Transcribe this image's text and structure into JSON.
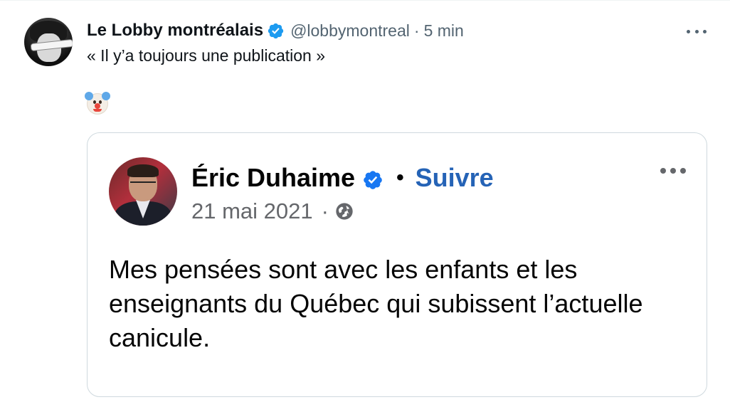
{
  "tweet": {
    "author_name": "Le Lobby montréalais",
    "handle": "@lobbymontreal",
    "separator": "·",
    "time": "5 min",
    "text": "« Il y’a toujours une publication »",
    "emoji_icon": "clown-face-icon",
    "verified_color": "#1d9bf0"
  },
  "quoted_post": {
    "author_name": "Éric Duhaime",
    "separator": "•",
    "follow_label": "Suivre",
    "date": "21 mai 2021",
    "date_separator": "·",
    "privacy_icon": "globe-icon",
    "body": "Mes pensées sont avec les enfants et les enseignants du Québec qui subissent l’actuelle canicule.",
    "follow_color": "#2563b6",
    "verified_color": "#1877f2"
  }
}
